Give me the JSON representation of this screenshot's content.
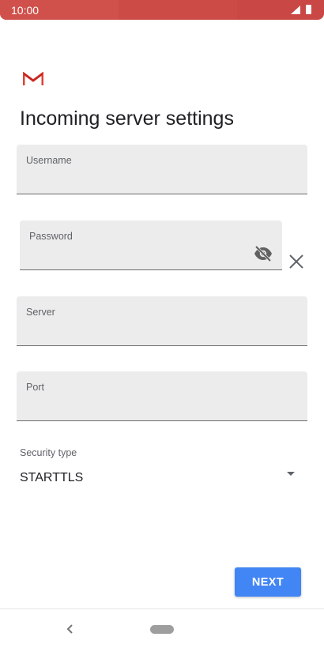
{
  "status_bar": {
    "time": "10:00"
  },
  "page": {
    "title": "Incoming server settings"
  },
  "fields": {
    "username": {
      "label": "Username",
      "value": ""
    },
    "password": {
      "label": "Password",
      "value": ""
    },
    "server": {
      "label": "Server",
      "value": ""
    },
    "port": {
      "label": "Port",
      "value": ""
    }
  },
  "security": {
    "label": "Security type",
    "value": "STARTTLS"
  },
  "actions": {
    "next_label": "NEXT"
  },
  "icons": {
    "logo": "gmail-logo",
    "password_toggle": "visibility-off-icon",
    "clear": "close-icon",
    "dropdown": "dropdown-arrow-icon",
    "nav_back": "back-chevron-icon",
    "nav_home": "home-pill-icon"
  },
  "colors": {
    "status_bar": "#c94744",
    "accent": "#4285f4",
    "field_bg": "#ececec"
  }
}
